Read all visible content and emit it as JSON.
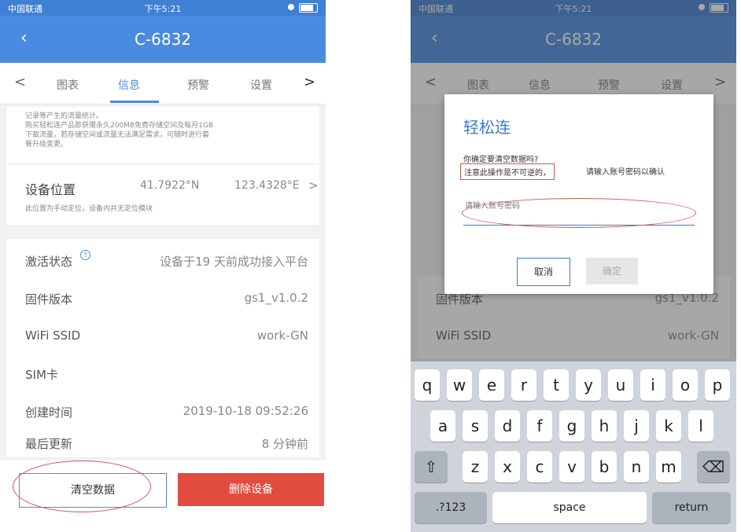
{
  "status": {
    "carrier": "中国联通",
    "time": "下午5:21"
  },
  "nav": {
    "back": "‹",
    "title": "C-6832"
  },
  "tabs": {
    "left_arrow": "<",
    "right_arrow": ">",
    "items": [
      "图表",
      "信息",
      "预警",
      "设置"
    ],
    "active": 1
  },
  "info": {
    "note_lines": [
      "记录等产生的流量统计。",
      "购买轻松连产品即获赠永久200MB免费存储空间及每月1GB",
      "下载流量，若存储空间或流量无法满足需求，可随时进行套",
      "餐升级变更。"
    ],
    "location_label": "设备位置",
    "lat": "41.7922°N",
    "lon": "123.4328°E",
    "location_chevron": ">",
    "location_note": "此位置为手动定位，设备内并无定位模块",
    "rows": [
      {
        "label": "激活状态",
        "value": "设备于19 天前成功接入平台"
      },
      {
        "label": "固件版本",
        "value": "gs1_v1.0.2"
      },
      {
        "label": "WiFi SSID",
        "value": "work-GN"
      },
      {
        "label": "SIM卡",
        "value": ""
      },
      {
        "label": "创建时间",
        "value": "2019-10-18 09:52:26"
      },
      {
        "label": "最后更新",
        "value": "8 分钟前"
      }
    ],
    "help_icon": "?"
  },
  "buttons": {
    "clear": "清空数据",
    "delete": "删除设备"
  },
  "dialog": {
    "title": "轻松连",
    "question": "你确定要清空数据吗?",
    "warning": "注意此操作是不可逆的，",
    "instruction": "请输入账号密码以确认",
    "placeholder": "请输入账号密码",
    "cancel": "取消",
    "confirm": "确定"
  },
  "keyboard": {
    "row1": [
      "q",
      "w",
      "e",
      "r",
      "t",
      "y",
      "u",
      "i",
      "o",
      "p"
    ],
    "row2": [
      "a",
      "s",
      "d",
      "f",
      "g",
      "h",
      "j",
      "k",
      "l"
    ],
    "row3": [
      "z",
      "x",
      "c",
      "v",
      "b",
      "n",
      "m"
    ],
    "shift": "⇧",
    "backspace": "⌫",
    "numbers": ".?123",
    "space": "space",
    "return": "return"
  },
  "colors": {
    "primary": "#4a8ae0",
    "danger": "#e24c3f",
    "annotation": "#d9534f"
  }
}
